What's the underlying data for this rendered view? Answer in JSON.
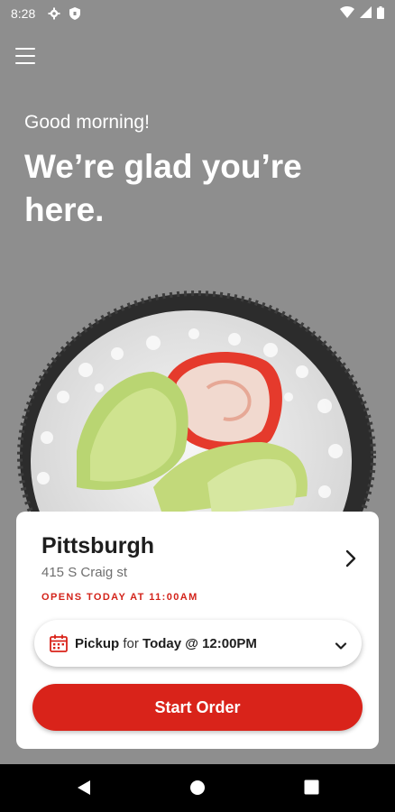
{
  "status_bar": {
    "time": "8:28",
    "icons": [
      "gear-icon",
      "shield-icon",
      "wifi-icon",
      "cellular-icon",
      "battery-icon"
    ]
  },
  "header": {
    "menu_icon": "hamburger-menu-icon"
  },
  "hero": {
    "greeting": "Good morning!",
    "headline": "We’re glad you’re here."
  },
  "location_card": {
    "city": "Pittsburgh",
    "address": "415 S Craig st",
    "hours": "OPENS TODAY AT 11:00AM",
    "pickup": {
      "mode": "Pickup",
      "connector": "for",
      "time": "Today @ 12:00PM",
      "icon": "calendar-icon"
    },
    "start_button": "Start Order"
  },
  "colors": {
    "accent": "#d9231a",
    "overlay": "#8e8e8e",
    "card": "#ffffff"
  },
  "nav_bar": {
    "icons": [
      "back-icon",
      "home-icon",
      "recents-icon"
    ]
  }
}
